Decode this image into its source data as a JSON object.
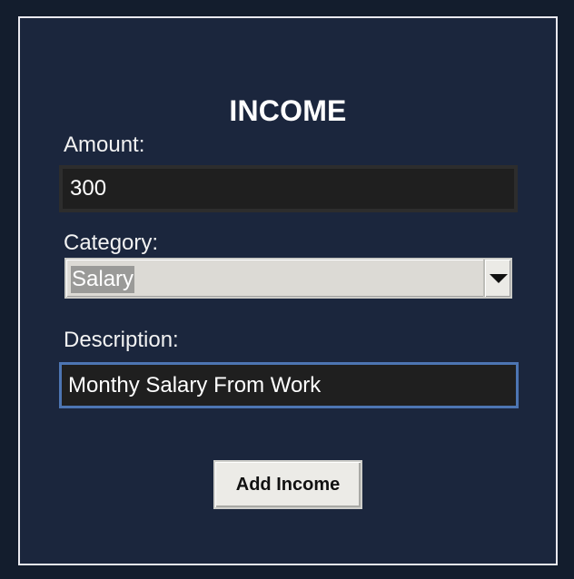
{
  "form": {
    "title": "INCOME",
    "amount": {
      "label": "Amount:",
      "value": "300"
    },
    "category": {
      "label": "Category:",
      "selected": "Salary"
    },
    "description": {
      "label": "Description:",
      "value": "Monthy Salary From Work"
    },
    "submit_label": "Add Income"
  },
  "icons": {
    "dropdown": "chevron-down-icon"
  },
  "colors": {
    "background": "#131d2d",
    "panel": "#1b263d",
    "field_background": "#1f1f1f",
    "focus_border": "#4d75b2",
    "button_background": "#ecebe7"
  }
}
